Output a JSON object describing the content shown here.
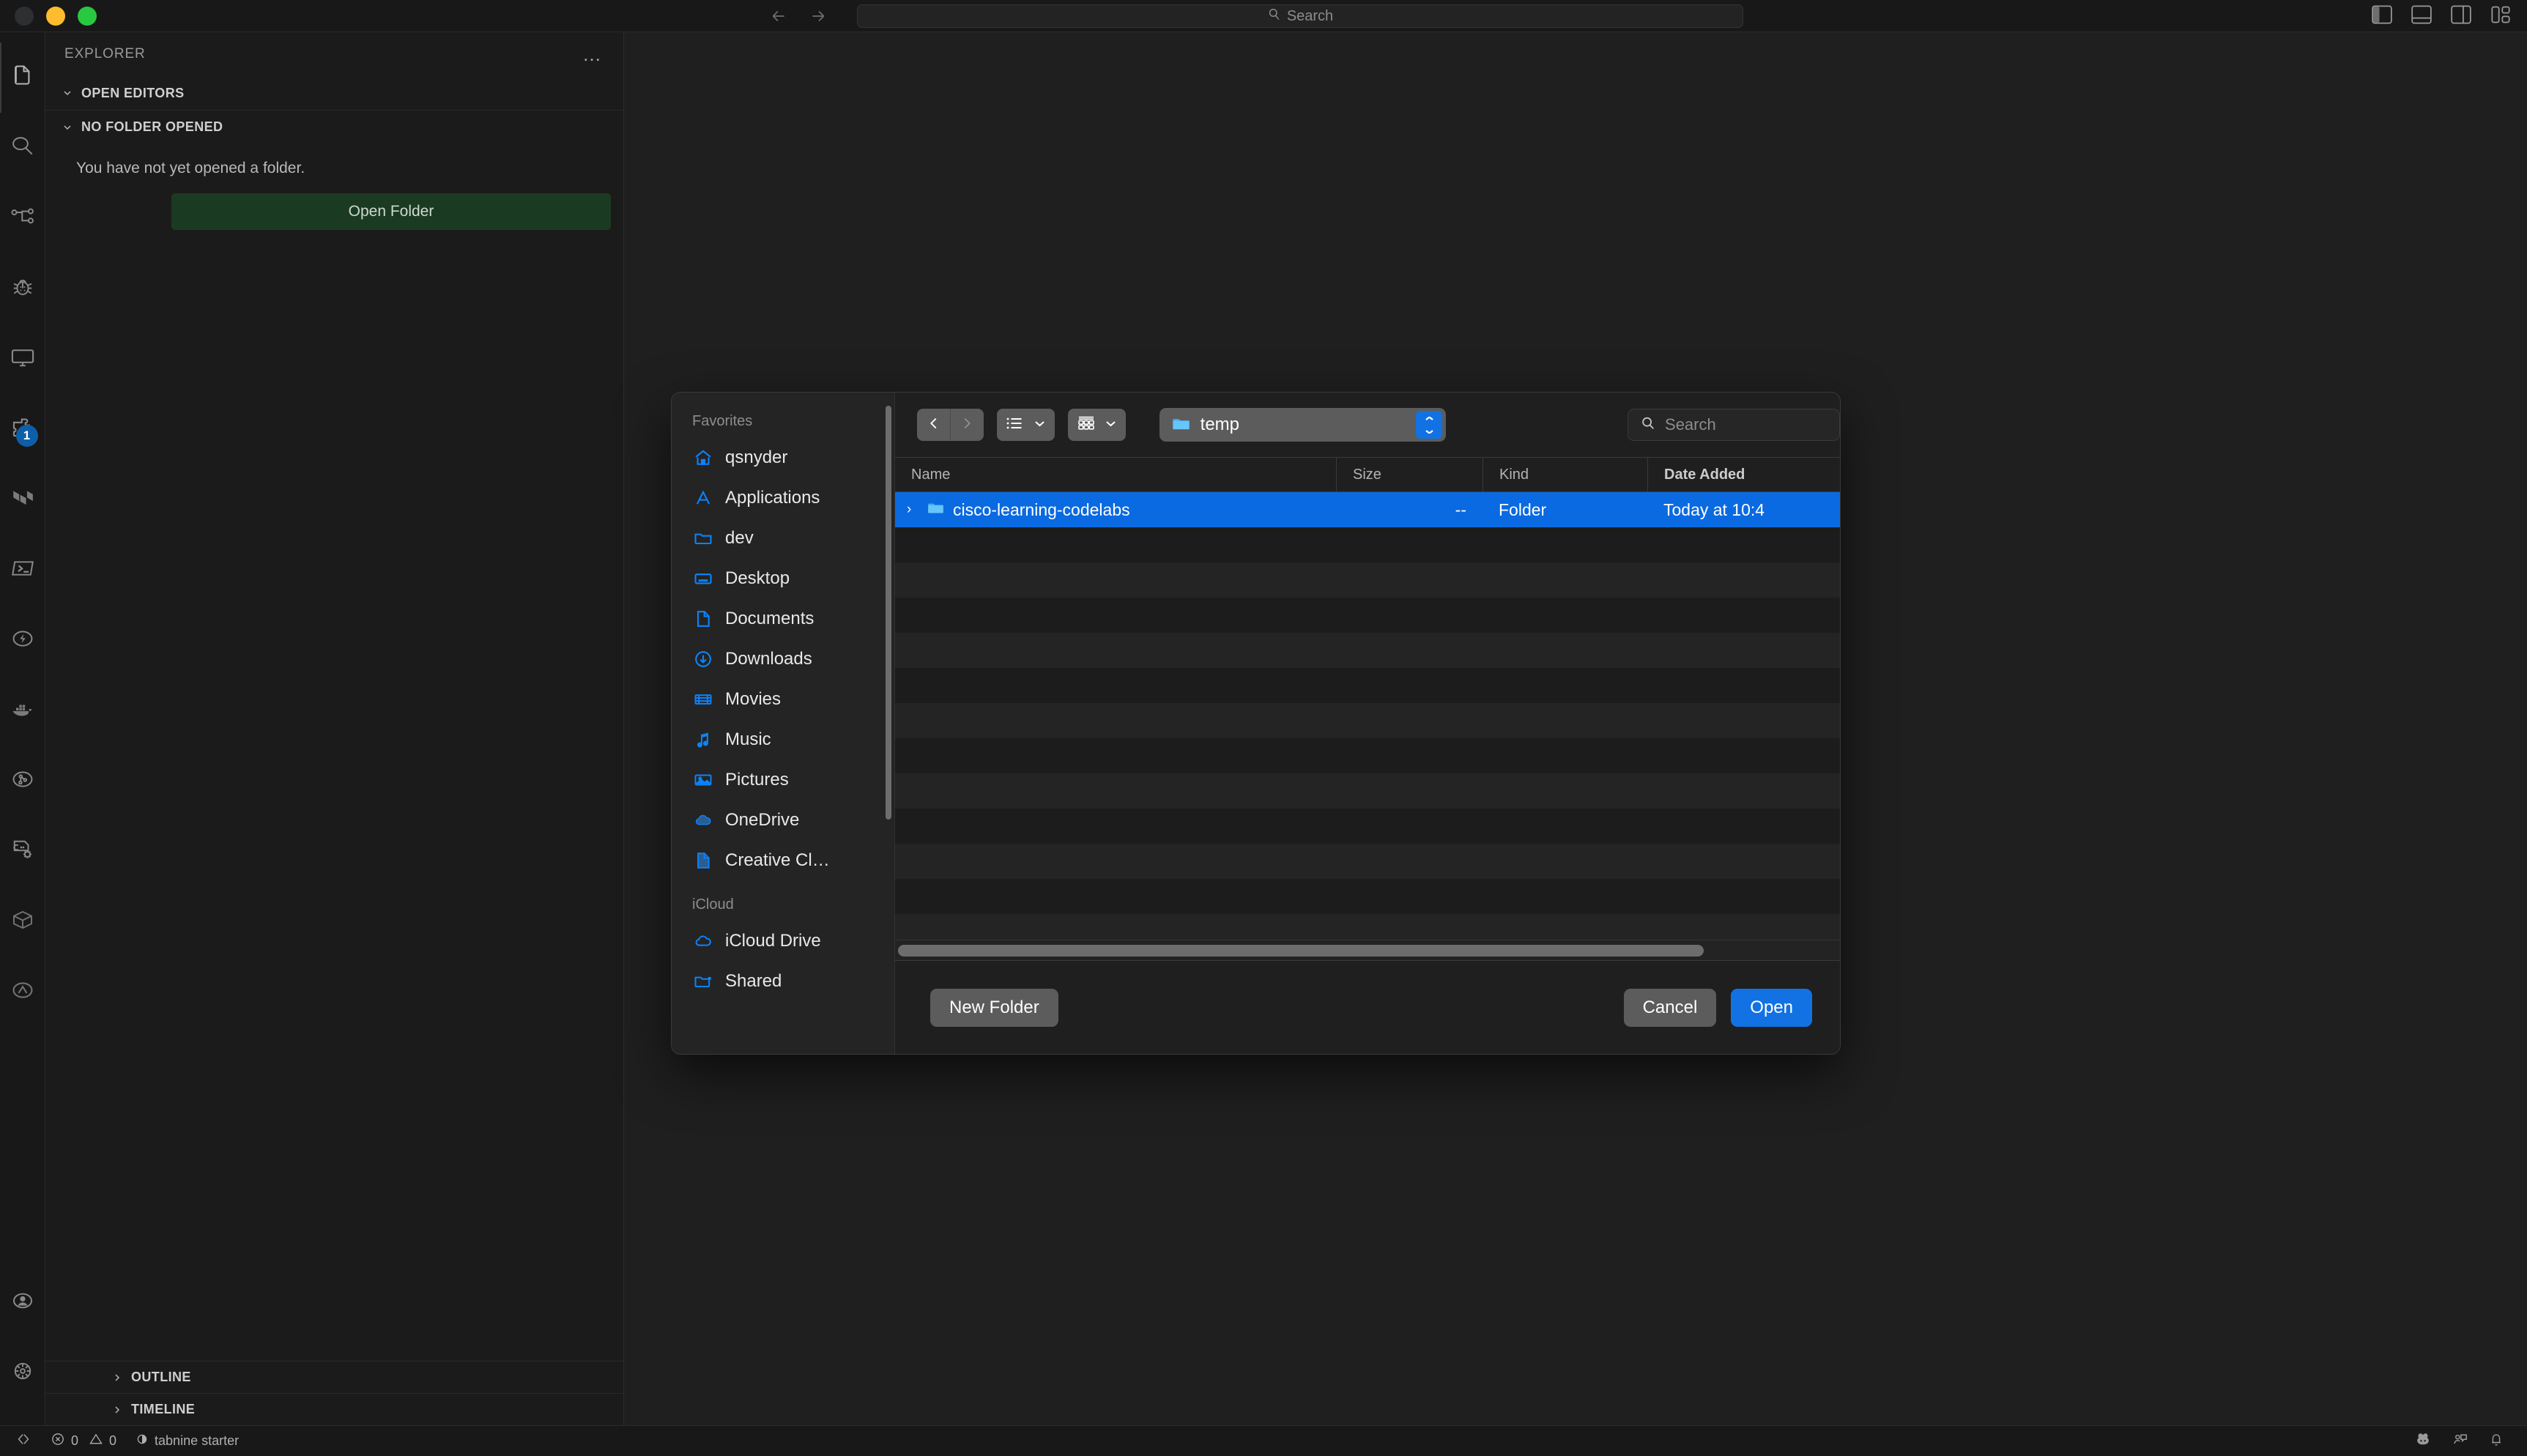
{
  "titlebar": {
    "search_placeholder": "Search",
    "search_icon": "magnifier-icon",
    "back_icon": "arrow-left-icon",
    "forward_icon": "arrow-right-icon",
    "layout_icons": [
      {
        "name": "toggle-primary-sidebar-icon",
        "active": true
      },
      {
        "name": "toggle-panel-icon",
        "active": false
      },
      {
        "name": "toggle-secondary-sidebar-icon",
        "active": false
      },
      {
        "name": "customize-layout-icon",
        "active": false
      }
    ],
    "traffic_lights": [
      {
        "name": "close-button",
        "color": "#2d2f31"
      },
      {
        "name": "minimize-button",
        "color": "#febc2e"
      },
      {
        "name": "maximize-button",
        "color": "#28c840"
      }
    ]
  },
  "activitybar": {
    "items": [
      {
        "name": "explorer-icon",
        "label": "Explorer",
        "active": true
      },
      {
        "name": "search-icon",
        "label": "Search",
        "active": false
      },
      {
        "name": "source-control-icon",
        "label": "Source Control",
        "active": false
      },
      {
        "name": "run-and-debug-icon",
        "label": "Run and Debug",
        "active": false
      },
      {
        "name": "remote-explorer-icon",
        "label": "Remote Explorer",
        "active": false
      },
      {
        "name": "extensions-icon",
        "label": "Extensions",
        "active": false,
        "badge": "1"
      },
      {
        "name": "terraform-icon",
        "label": "Terraform",
        "active": false
      },
      {
        "name": "terminal-icon",
        "label": "Terminal",
        "active": false
      },
      {
        "name": "thunder-client-icon",
        "label": "Thunder Client",
        "active": false
      },
      {
        "name": "docker-icon",
        "label": "Docker",
        "active": false
      },
      {
        "name": "test-explorer-icon",
        "label": "Testing",
        "active": false
      },
      {
        "name": "cmake-tools-icon",
        "label": "CMake Tools",
        "active": false
      },
      {
        "name": "database-icon",
        "label": "Database",
        "active": false
      },
      {
        "name": "arduino-icon",
        "label": "Arduino",
        "active": false
      }
    ],
    "bottom_items": [
      {
        "name": "accounts-icon",
        "label": "Accounts"
      },
      {
        "name": "settings-gear-icon",
        "label": "Manage"
      }
    ]
  },
  "sidebar": {
    "title": "EXPLORER",
    "more_actions": "…",
    "sections": [
      {
        "name": "open-editors",
        "label": "OPEN EDITORS",
        "expanded": true
      },
      {
        "name": "no-folder-opened",
        "label": "NO FOLDER OPENED",
        "expanded": true
      }
    ],
    "empty_message": "You have not yet opened a folder.",
    "open_folder_button": "Open Folder",
    "footer_sections": [
      {
        "name": "outline",
        "label": "OUTLINE",
        "expanded": false
      },
      {
        "name": "timeline",
        "label": "TIMELINE",
        "expanded": false
      }
    ]
  },
  "statusbar": {
    "remote_icon": "remote-window-icon",
    "errors_icon": "error-circle-icon",
    "errors": "0",
    "warnings_icon": "warning-triangle-icon",
    "warnings": "0",
    "tabnine_icon": "tabnine-icon",
    "tabnine_label": "tabnine starter",
    "right_icons": [
      {
        "name": "copilot-icon"
      },
      {
        "name": "feedback-icon"
      },
      {
        "name": "notifications-bell-icon"
      }
    ]
  },
  "dialog": {
    "sidebar": {
      "groups": [
        {
          "name": "favorites",
          "title": "Favorites",
          "items": [
            {
              "label": "qsnyder",
              "icon": "home-icon"
            },
            {
              "label": "Applications",
              "icon": "applications-icon"
            },
            {
              "label": "dev",
              "icon": "folder-icon"
            },
            {
              "label": "Desktop",
              "icon": "desktop-icon"
            },
            {
              "label": "Documents",
              "icon": "document-icon"
            },
            {
              "label": "Downloads",
              "icon": "downloads-icon"
            },
            {
              "label": "Movies",
              "icon": "movies-icon"
            },
            {
              "label": "Music",
              "icon": "music-note-icon"
            },
            {
              "label": "Pictures",
              "icon": "pictures-icon"
            },
            {
              "label": "OneDrive",
              "icon": "cloud-icon"
            },
            {
              "label": "Creative Cl…",
              "icon": "document-icon"
            }
          ]
        },
        {
          "name": "icloud",
          "title": "iCloud",
          "items": [
            {
              "label": "iCloud Drive",
              "icon": "cloud-outline-icon"
            },
            {
              "label": "Shared",
              "icon": "shared-folder-icon"
            }
          ]
        }
      ]
    },
    "toolbar": {
      "back_icon": "chevron-left-icon",
      "forward_icon": "chevron-right-icon",
      "list_view_icon": "list-view-icon",
      "list_view_chevron": "chevron-down-icon",
      "group_view_icon": "group-view-icon",
      "group_view_chevron": "chevron-down-icon",
      "path_folder_icon": "folder-icon",
      "path_label": "temp",
      "path_stepper_icon": "up-down-stepper-icon",
      "search_icon": "magnifier-icon",
      "search_placeholder": "Search"
    },
    "columns": [
      {
        "key": "name",
        "label": "Name"
      },
      {
        "key": "size",
        "label": "Size"
      },
      {
        "key": "kind",
        "label": "Kind"
      },
      {
        "key": "date",
        "label": "Date Added"
      }
    ],
    "rows": [
      {
        "name": "cisco-learning-codelabs",
        "size": "--",
        "kind": "Folder",
        "date": "Today at 10:4",
        "selected": true,
        "icon": "folder-icon",
        "disclosure": "›"
      }
    ],
    "footer": {
      "new_folder_label": "New Folder",
      "cancel_label": "Cancel",
      "open_label": "Open"
    }
  }
}
